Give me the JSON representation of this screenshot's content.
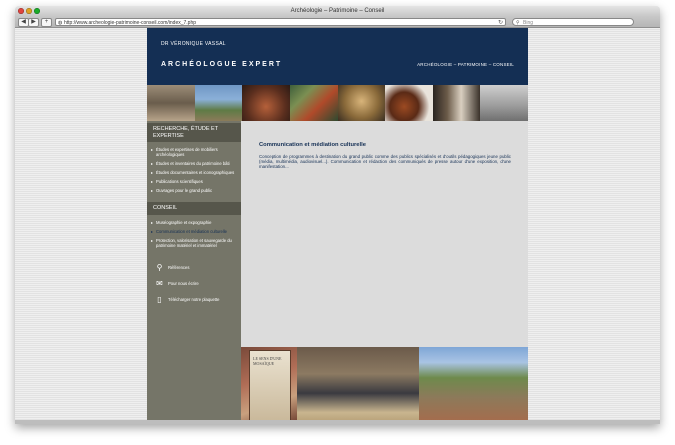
{
  "window": {
    "title": "Archéologie – Patrimoine – Conseil",
    "url": "http://www.archeologie-patrimoine-conseil.com/index_7.php",
    "search_placeholder": "Bing"
  },
  "header": {
    "author": "DR VÉRONIQUE VASSAL",
    "title": "ARCHÉOLOGUE EXPERT",
    "tagline": "ARCHÉOLOGIE – PATRIMOINE – CONSEIL"
  },
  "sidebar": {
    "sections": [
      {
        "heading": "RECHERCHE, ÉTUDE ET EXPERTISE",
        "items": [
          {
            "label": "Études et expertises de mobiliers archéologiques",
            "active": false
          },
          {
            "label": "Études et inventaires du patrimoine bâti",
            "active": false
          },
          {
            "label": "Études documentaires et iconographiques",
            "active": false
          },
          {
            "label": "Publications scientifiques",
            "active": false
          },
          {
            "label": "Ouvrages pour le grand public",
            "active": false
          }
        ]
      },
      {
        "heading": "CONSEIL",
        "items": [
          {
            "label": "Muséographie et expographie",
            "active": false
          },
          {
            "label": "Communication et médiation culturelle",
            "active": true
          },
          {
            "label": "Protection, valorisation et sauvegarde du patrimoine matériel et immatériel",
            "active": false
          }
        ]
      }
    ],
    "links": [
      {
        "label": "Références",
        "icon": "magnifier-icon"
      },
      {
        "label": "Pour nous écrire",
        "icon": "envelope-icon"
      },
      {
        "label": "Télécharger notre plaquette",
        "icon": "document-icon"
      }
    ]
  },
  "main": {
    "title": "Communication et médiation culturelle",
    "text": "Conception de programmes à destination du grand public comme des publics spécialisés et d'outils pédagogiques jeune public (média, multimédia, audiovisuel...). Communication et rédaction des communiqués de presse autour d'une exposition, d'une manifestation..."
  },
  "bottom": {
    "book_title": "LE SENS D'UNE MOSAÏQUE"
  },
  "colors": {
    "header_bg": "#142f54",
    "sidebar_bg": "#757568",
    "sidebar_heading_bg": "#56564b",
    "content_bg": "#dcdcdc",
    "accent_text": "#142f54"
  }
}
